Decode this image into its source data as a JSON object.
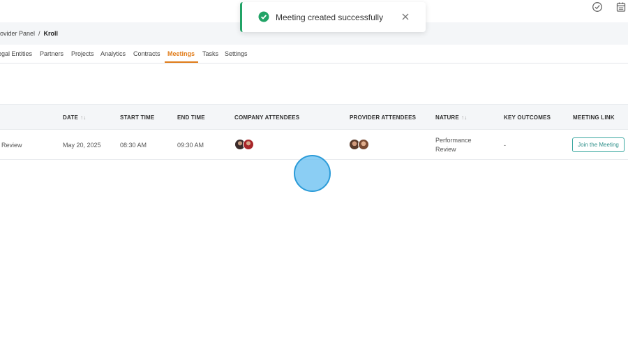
{
  "breadcrumb": {
    "parent": "rovider Panel",
    "separator": "/",
    "current": "Kroll"
  },
  "tabs": [
    {
      "label": "egal Entities",
      "active": false
    },
    {
      "label": "Partners",
      "active": false
    },
    {
      "label": "Projects",
      "active": false
    },
    {
      "label": "Analytics",
      "active": false
    },
    {
      "label": "Contracts",
      "active": false
    },
    {
      "label": "Meetings",
      "active": true
    },
    {
      "label": "Tasks",
      "active": false
    },
    {
      "label": "Settings",
      "active": false
    }
  ],
  "table": {
    "headers": {
      "date": "DATE",
      "start_time": "START TIME",
      "end_time": "END TIME",
      "company_attendees": "COMPANY ATTENDEES",
      "provider_attendees": "PROVIDER ATTENDEES",
      "nature": "NATURE",
      "key_outcomes": "KEY OUTCOMES",
      "meeting_link": "MEETING LINK"
    },
    "sort_glyph": "↑↓",
    "rows": [
      {
        "title": "Review",
        "date": "May 20, 2025",
        "start_time": "08:30 AM",
        "end_time": "09:30 AM",
        "nature": "Performance Review",
        "key_outcomes": "-",
        "link_label": "Join the Meeting"
      }
    ]
  },
  "toast": {
    "message": "Meeting created successfully",
    "type": "success"
  },
  "colors": {
    "accent": "#e07b18",
    "success": "#21a366",
    "link_button": "#3aa7a0",
    "header_bg": "#f4f6f8"
  },
  "icons": {
    "top_left": "check-circle-icon",
    "top_right": "calendar-icon",
    "toast": "success-check-icon",
    "toast_close": "close-icon"
  }
}
